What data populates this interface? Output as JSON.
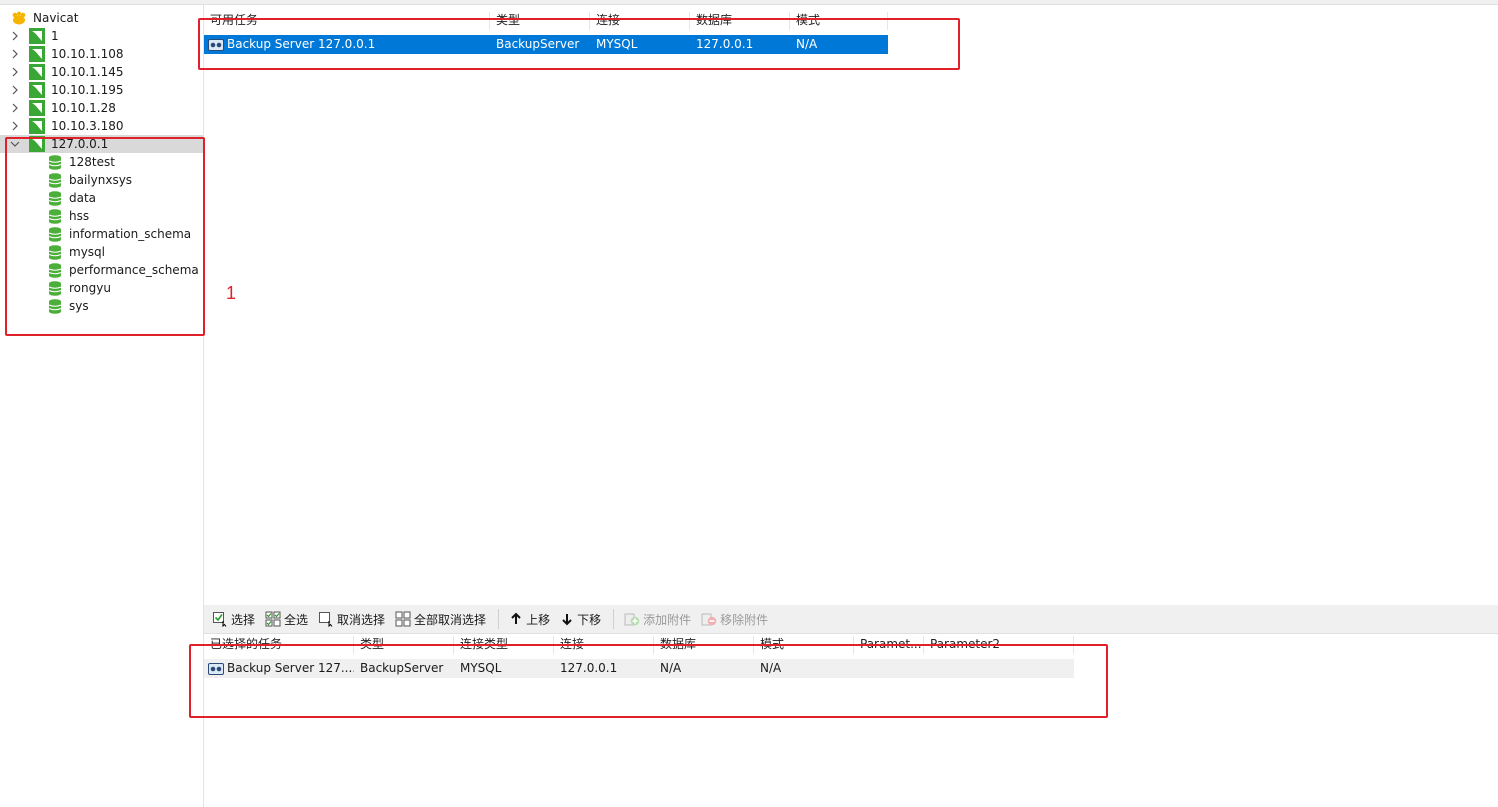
{
  "sidebar": {
    "root": {
      "label": "Navicat"
    },
    "connections": [
      {
        "label": "1",
        "expanded": false
      },
      {
        "label": "10.10.1.108",
        "expanded": false
      },
      {
        "label": "10.10.1.145",
        "expanded": false
      },
      {
        "label": "10.10.1.195",
        "expanded": false
      },
      {
        "label": "10.10.1.28",
        "expanded": false
      },
      {
        "label": "10.10.3.180",
        "expanded": false
      },
      {
        "label": "127.0.0.1",
        "expanded": true
      }
    ],
    "databases": [
      "128test",
      "bailynxsys",
      "data",
      "hss",
      "information_schema",
      "mysql",
      "performance_schema",
      "rongyu",
      "sys"
    ]
  },
  "available_tasks": {
    "headers": [
      "可用任务",
      "类型",
      "连接",
      "数据库",
      "模式"
    ],
    "rows": [
      {
        "name": "Backup Server 127.0.0.1",
        "type": "BackupServer",
        "connection": "MYSQL",
        "database": "127.0.0.1",
        "schema": "N/A"
      }
    ]
  },
  "toolbar": {
    "select": "选择",
    "select_all": "全选",
    "deselect": "取消选择",
    "deselect_all": "全部取消选择",
    "move_up": "上移",
    "move_down": "下移",
    "add_attachment": "添加附件",
    "remove_attachment": "移除附件"
  },
  "selected_tasks": {
    "headers": [
      "已选择的任务",
      "类型",
      "连接类型",
      "连接",
      "数据库",
      "模式",
      "Paramet...",
      "Parameter2"
    ],
    "rows": [
      {
        "name": "Backup Server 127....",
        "type": "BackupServer",
        "conn_type": "MYSQL",
        "connection": "127.0.0.1",
        "database": "N/A",
        "schema": "N/A",
        "p1": "",
        "p2": ""
      }
    ]
  },
  "annotation": {
    "label": "1"
  },
  "colors": {
    "selection": "#0078d7",
    "annotation_red": "#e0202a",
    "mysql_green": "#3aa635",
    "db_green": "#4caf3a"
  }
}
